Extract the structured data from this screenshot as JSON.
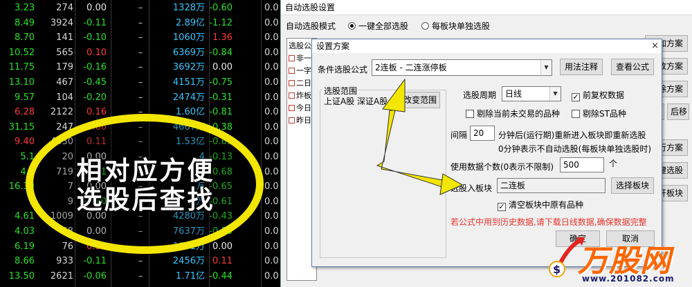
{
  "stocks": [
    {
      "price": "3.23",
      "price_color": "green",
      "vol": "274",
      "pct": "0.00",
      "pct_color": "white",
      "dash": "–",
      "amount": "1328万",
      "change": "-0.60",
      "change_color": "green",
      "tail": "0.0"
    },
    {
      "price": "8.49",
      "price_color": "green",
      "vol": "3924",
      "pct": "-0.11",
      "pct_color": "green",
      "dash": "–",
      "amount": "2.89亿",
      "change": "-1.12",
      "change_color": "green",
      "tail": "0.0"
    },
    {
      "price": "8.70",
      "price_color": "green",
      "vol": "141",
      "pct": "-0.10",
      "pct_color": "green",
      "dash": "–",
      "amount": "1060万",
      "change": "1.36",
      "change_color": "red",
      "tail": "0.0"
    },
    {
      "price": "10.52",
      "price_color": "green",
      "vol": "565",
      "pct": "0.10",
      "pct_color": "red",
      "dash": "–",
      "amount": "6369万",
      "change": "-0.84",
      "change_color": "green",
      "tail": "0.0"
    },
    {
      "price": "11.75",
      "price_color": "green",
      "vol": "179",
      "pct": "-0.16",
      "pct_color": "green",
      "dash": "–",
      "amount": "3692万",
      "change": "0.00",
      "change_color": "white",
      "tail": "0.0"
    },
    {
      "price": "13.10",
      "price_color": "green",
      "vol": "467",
      "pct": "-0.45",
      "pct_color": "green",
      "dash": "–",
      "amount": "4151万",
      "change": "-0.75",
      "change_color": "green",
      "tail": "0.0"
    },
    {
      "price": "9.57",
      "price_color": "green",
      "vol": "104",
      "pct": "-0.20",
      "pct_color": "green",
      "dash": "–",
      "amount": "2474万",
      "change": "-0.31",
      "change_color": "green",
      "tail": "0.0"
    },
    {
      "price": "6.28",
      "price_color": "red",
      "vol": "2122",
      "pct": "0.16",
      "pct_color": "red",
      "dash": "–",
      "amount": "1.60亿",
      "change": "-0.81",
      "change_color": "green",
      "tail": "0.0"
    },
    {
      "price": "31.15",
      "price_color": "green",
      "vol": "247",
      "pct": "0.06",
      "pct_color": "red",
      "dash": "–",
      "amount": "4667万",
      "change": "-0.38",
      "change_color": "green",
      "tail": "0.0"
    },
    {
      "price": "9.40",
      "price_color": "red",
      "vol": "4330",
      "pct": "0.11",
      "pct_color": "red",
      "dash": "–",
      "amount": "1.53亿",
      "change": "-0.69",
      "change_color": "green",
      "tail": "0.0"
    },
    {
      "price": "5.1",
      "price_color": "green",
      "vol": "20",
      "pct": "0.00",
      "pct_color": "white",
      "dash": "–",
      "amount": "4",
      "change": "-0.13",
      "change_color": "green",
      "tail": "0.0"
    },
    {
      "price": "4.1",
      "price_color": "green",
      "vol": "719",
      "pct": "-0.21",
      "pct_color": "green",
      "dash": "–",
      "amount": "2亿",
      "change": "-0.68",
      "change_color": "green",
      "tail": "0.0"
    },
    {
      "price": "16.39",
      "price_color": "green",
      "vol": "7",
      "pct": "0.00",
      "pct_color": "white",
      "dash": "–",
      "amount": "万",
      "change": "-0.65",
      "change_color": "green",
      "tail": "0.0"
    },
    {
      "price": "1",
      "price_color": "green",
      "vol": "9",
      "pct": "-0.10",
      "pct_color": "green",
      "dash": "–",
      "amount": "万",
      "change": "-0.61",
      "change_color": "green",
      "tail": "0.0"
    },
    {
      "price": "4.61",
      "price_color": "green",
      "vol": "1009",
      "pct": "0.00",
      "pct_color": "white",
      "dash": "–",
      "amount": "4280万",
      "change": "-0.43",
      "change_color": "green",
      "tail": "0.0"
    },
    {
      "price": "4.03",
      "price_color": "green",
      "vol": "58",
      "pct": "0.00",
      "pct_color": "white",
      "dash": "–",
      "amount": "7637万",
      "change": "-0.50",
      "change_color": "green",
      "tail": "0.0"
    },
    {
      "price": "6.19",
      "price_color": "green",
      "vol": "76",
      "pct": "0.32",
      "pct_color": "red",
      "dash": "–",
      "amount": "1031万",
      "change": "0.00",
      "change_color": "white",
      "tail": "0.0"
    },
    {
      "price": "8.66",
      "price_color": "green",
      "vol": "933",
      "pct": "-0.11",
      "pct_color": "green",
      "dash": "–",
      "amount": "2456万",
      "change": "0.11",
      "change_color": "red",
      "tail": "0.0"
    },
    {
      "price": "13.50",
      "price_color": "green",
      "vol": "2621",
      "pct": "-0.06",
      "pct_color": "green",
      "dash": "–",
      "amount": "1.71亿",
      "change": "-0.44",
      "change_color": "green",
      "tail": "0.0"
    }
  ],
  "outer": {
    "title": "自动选股设置",
    "mode_label": "自动选股模式",
    "mode_all": "一键全部选股",
    "mode_each": "每板块单独选股",
    "list_header": "选股公",
    "list_items": [
      "非一",
      "一字",
      "二日",
      "炸板",
      "今日",
      "昨日"
    ],
    "right_buttons": [
      "加方案",
      "改方案",
      "除方案",
      "后移",
      "行方案",
      "键选股",
      "开板块"
    ],
    "right_button_extra": "移"
  },
  "inner": {
    "title": "设置方案",
    "close": "×",
    "formula_label": "条件选股公式",
    "formula_value": "2连板          - 二连涨停板",
    "usage_button": "用法注释",
    "view_button": "查看公式",
    "range_group": "选股范围",
    "range_value": "上证A股 深证A股",
    "change_range_button": "改变范围",
    "period_label": "选股周期",
    "period_value": "日线",
    "adj_label": "前复权数据",
    "exclude_halt": "剔除当前未交易的品种",
    "exclude_st": "剔除ST品种",
    "interval_label": "间隔",
    "interval_value": "20",
    "interval_text": "分钟后(运行期)重新进入板块即重新选股",
    "interval_note": "0分钟表示不自动选股(每板块单独选股时)",
    "count_label": "使用数据个数(0表示不限制)",
    "count_value": "500",
    "count_unit": "个",
    "block_label": "选股入板块",
    "block_value": "二连板",
    "choose_block_button": "选择板块",
    "clear_label": "清空板块中原有品种",
    "warning": "若公式中用到历史数据,请下载日线数据,确保数据完整",
    "ok_button": "确定",
    "cancel_button": "取消",
    "checkmark": "✓"
  },
  "annotation": {
    "line1": "相对应方便",
    "line2": "选股后查找"
  },
  "logo": {
    "name": "万股网",
    "url": "www.201082.com",
    "mark": "$"
  },
  "colors": {
    "red": "#ff3b3b",
    "green": "#27e327",
    "cyan": "#38c8ff",
    "yellow": "#f3e600",
    "warning": "#e8332a"
  }
}
